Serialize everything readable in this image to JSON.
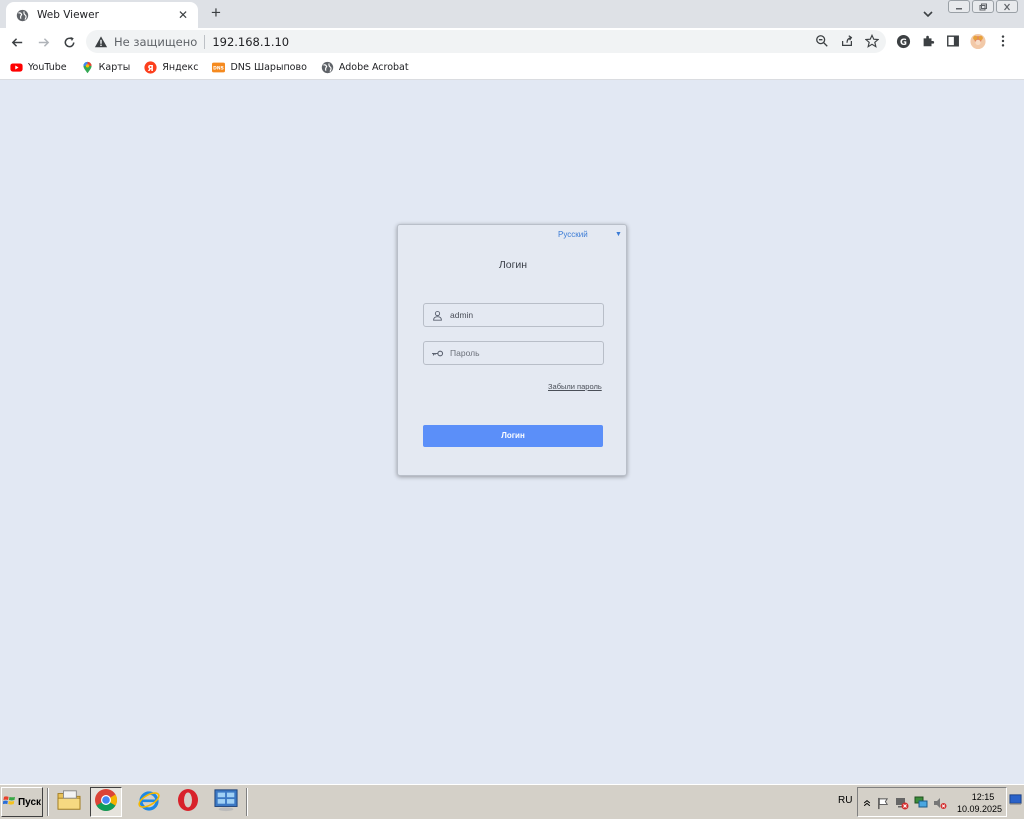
{
  "browser": {
    "tab_title": "Web Viewer",
    "tab_close": "✕",
    "new_tab": "+",
    "security_label": "Не защищено",
    "url": "192.168.1.10"
  },
  "bookmarks": [
    {
      "label": "YouTube",
      "icon": "youtube-icon"
    },
    {
      "label": "Карты",
      "icon": "maps-icon"
    },
    {
      "label": "Яндекс",
      "icon": "yandex-icon"
    },
    {
      "label": "DNS Шарыпово",
      "icon": "dns-icon"
    },
    {
      "label": "Adobe Acrobat",
      "icon": "globe-icon"
    }
  ],
  "login": {
    "language": "Русский",
    "title": "Логин",
    "username_value": "admin",
    "password_placeholder": "Пароль",
    "forgot_link": "Забыли пароль",
    "submit_label": "Логин"
  },
  "taskbar": {
    "start_label": "Пуск",
    "language": "RU",
    "time": "12:15",
    "date": "10.09.2025"
  },
  "colors": {
    "page_background": "#e2e8f3",
    "login_button": "#5b8ff9",
    "language_link": "#3a7bd5"
  }
}
